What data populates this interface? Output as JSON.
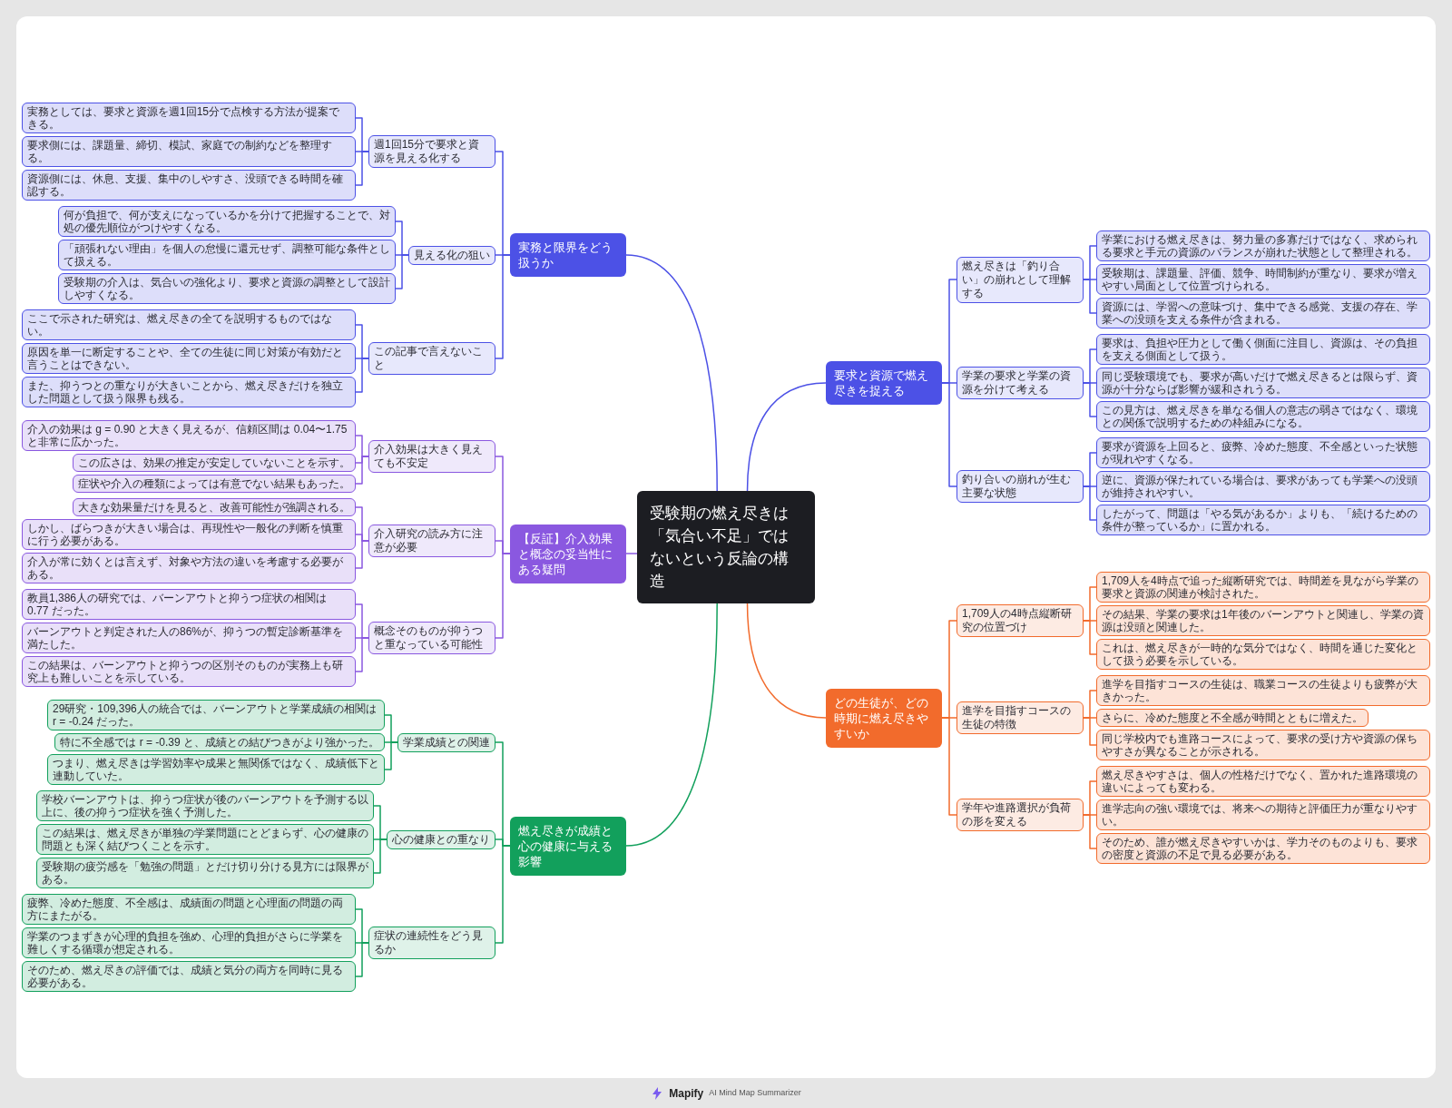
{
  "root": {
    "title": "受験期の燃え尽きは「気合い不足」ではないという反論の構造"
  },
  "branches": [
    {
      "title": "実務と限界をどう扱うか",
      "color": "#4c51e6",
      "children": [
        {
          "title": "週1回15分で要求と資源を見える化する",
          "children": [
            {
              "title": "実務としては、要求と資源を週1回15分で点検する方法が提案できる。"
            },
            {
              "title": "要求側には、課題量、締切、模試、家庭での制約などを整理する。"
            },
            {
              "title": "資源側には、休息、支援、集中のしやすさ、没頭できる時間を確認する。"
            }
          ]
        },
        {
          "title": "見える化の狙い",
          "children": [
            {
              "title": "何が負担で、何が支えになっているかを分けて把握することで、対処の優先順位がつけやすくなる。"
            },
            {
              "title": "「頑張れない理由」を個人の怠慢に還元せず、調整可能な条件として扱える。"
            },
            {
              "title": "受験期の介入は、気合いの強化より、要求と資源の調整として設計しやすくなる。"
            }
          ]
        },
        {
          "title": "この記事で言えないこと",
          "children": [
            {
              "title": "ここで示された研究は、燃え尽きの全てを説明するものではない。"
            },
            {
              "title": "原因を単一に断定することや、全ての生徒に同じ対策が有効だと言うことはできない。"
            },
            {
              "title": "また、抑うつとの重なりが大きいことから、燃え尽きだけを独立した問題として扱う限界も残る。"
            }
          ]
        }
      ]
    },
    {
      "title": "【反証】介入効果と概念の妥当性にある疑問",
      "color": "#8a58e0",
      "children": [
        {
          "title": "介入効果は大きく見えても不安定",
          "children": [
            {
              "title": "介入の効果は g = 0.90 と大きく見えるが、信頼区間は 0.04〜1.75 と非常に広かった。"
            },
            {
              "title": "この広さは、効果の推定が安定していないことを示す。"
            },
            {
              "title": "症状や介入の種類によっては有意でない結果もあった。"
            }
          ]
        },
        {
          "title": "介入研究の読み方に注意が必要",
          "children": [
            {
              "title": "大きな効果量だけを見ると、改善可能性が強調される。"
            },
            {
              "title": "しかし、ばらつきが大きい場合は、再現性や一般化の判断を慎重に行う必要がある。"
            },
            {
              "title": "介入が常に効くとは言えず、対象や方法の違いを考慮する必要がある。"
            }
          ]
        },
        {
          "title": "概念そのものが抑うつと重なっている可能性",
          "children": [
            {
              "title": "教員1,386人の研究では、バーンアウトと抑うつ症状の相関は 0.77 だった。"
            },
            {
              "title": "バーンアウトと判定された人の86%が、抑うつの暫定診断基準を満たした。"
            },
            {
              "title": "この結果は、バーンアウトと抑うつの区別そのものが実務上も研究上も難しいことを示している。"
            }
          ]
        }
      ]
    },
    {
      "title": "燃え尽きが成績と心の健康に与える影響",
      "color": "#12a05c",
      "children": [
        {
          "title": "学業成績との関連",
          "children": [
            {
              "title": "29研究・109,396人の統合では、バーンアウトと学業成績の相関は r = -0.24 だった。"
            },
            {
              "title": "特に不全感では r = -0.39 と、成績との結びつきがより強かった。"
            },
            {
              "title": "つまり、燃え尽きは学習効率や成果と無関係ではなく、成績低下と連動していた。"
            }
          ]
        },
        {
          "title": "心の健康との重なり",
          "children": [
            {
              "title": "学校バーンアウトは、抑うつ症状が後のバーンアウトを予測する以上に、後の抑うつ症状を強く予測した。"
            },
            {
              "title": "この結果は、燃え尽きが単独の学業問題にとどまらず、心の健康の問題とも深く結びつくことを示す。"
            },
            {
              "title": "受験期の疲労感を「勉強の問題」とだけ切り分ける見方には限界がある。"
            }
          ]
        },
        {
          "title": "症状の連続性をどう見るか",
          "children": [
            {
              "title": "疲弊、冷めた態度、不全感は、成績面の問題と心理面の問題の両方にまたがる。"
            },
            {
              "title": "学業のつまずきが心理的負担を強め、心理的負担がさらに学業を難しくする循環が想定される。"
            },
            {
              "title": "そのため、燃え尽きの評価では、成績と気分の両方を同時に見る必要がある。"
            }
          ]
        }
      ]
    },
    {
      "title": "要求と資源で燃え尽きを捉える",
      "color": "#4c51e6",
      "children": [
        {
          "title": "燃え尽きは「釣り合い」の崩れとして理解する",
          "children": [
            {
              "title": "学業における燃え尽きは、努力量の多寡だけではなく、求められる要求と手元の資源のバランスが崩れた状態として整理される。"
            },
            {
              "title": "受験期は、課題量、評価、競争、時間制約が重なり、要求が増えやすい局面として位置づけられる。"
            },
            {
              "title": "資源には、学習への意味づけ、集中できる感覚、支援の存在、学業への没頭を支える条件が含まれる。"
            }
          ]
        },
        {
          "title": "学業の要求と学業の資源を分けて考える",
          "children": [
            {
              "title": "要求は、負担や圧力として働く側面に注目し、資源は、その負担を支える側面として扱う。"
            },
            {
              "title": "同じ受験環境でも、要求が高いだけで燃え尽きるとは限らず、資源が十分ならば影響が緩和されうる。"
            },
            {
              "title": "この見方は、燃え尽きを単なる個人の意志の弱さではなく、環境との関係で説明するための枠組みになる。"
            }
          ]
        },
        {
          "title": "釣り合いの崩れが生む主要な状態",
          "children": [
            {
              "title": "要求が資源を上回ると、疲弊、冷めた態度、不全感といった状態が現れやすくなる。"
            },
            {
              "title": "逆に、資源が保たれている場合は、要求があっても学業への没頭が維持されやすい。"
            },
            {
              "title": "したがって、問題は「やる気があるか」よりも、「続けるための条件が整っているか」に置かれる。"
            }
          ]
        }
      ]
    },
    {
      "title": "どの生徒が、どの時期に燃え尽きやすいか",
      "color": "#f26b2c",
      "children": [
        {
          "title": "1,709人の4時点縦断研究の位置づけ",
          "children": [
            {
              "title": "1,709人を4時点で追った縦断研究では、時間差を見ながら学業の要求と資源の関連が検討された。"
            },
            {
              "title": "その結果、学業の要求は1年後のバーンアウトと関連し、学業の資源は没頭と関連した。"
            },
            {
              "title": "これは、燃え尽きが一時的な気分ではなく、時間を通じた変化として扱う必要を示している。"
            }
          ]
        },
        {
          "title": "進学を目指すコースの生徒の特徴",
          "children": [
            {
              "title": "進学を目指すコースの生徒は、職業コースの生徒よりも疲弊が大きかった。"
            },
            {
              "title": "さらに、冷めた態度と不全感が時間とともに増えた。"
            },
            {
              "title": "同じ学校内でも進路コースによって、要求の受け方や資源の保ちやすさが異なることが示される。"
            }
          ]
        },
        {
          "title": "学年や進路選択が負荷の形を変える",
          "children": [
            {
              "title": "燃え尽きやすさは、個人の性格だけでなく、置かれた進路環境の違いによっても変わる。"
            },
            {
              "title": "進学志向の強い環境では、将来への期待と評価圧力が重なりやすい。"
            },
            {
              "title": "そのため、誰が燃え尽きやすいかは、学力そのものよりも、要求の密度と資源の不足で見る必要がある。"
            }
          ]
        }
      ]
    }
  ],
  "footer": {
    "brand": "Mapify",
    "tagline": "AI Mind Map Summarizer"
  }
}
